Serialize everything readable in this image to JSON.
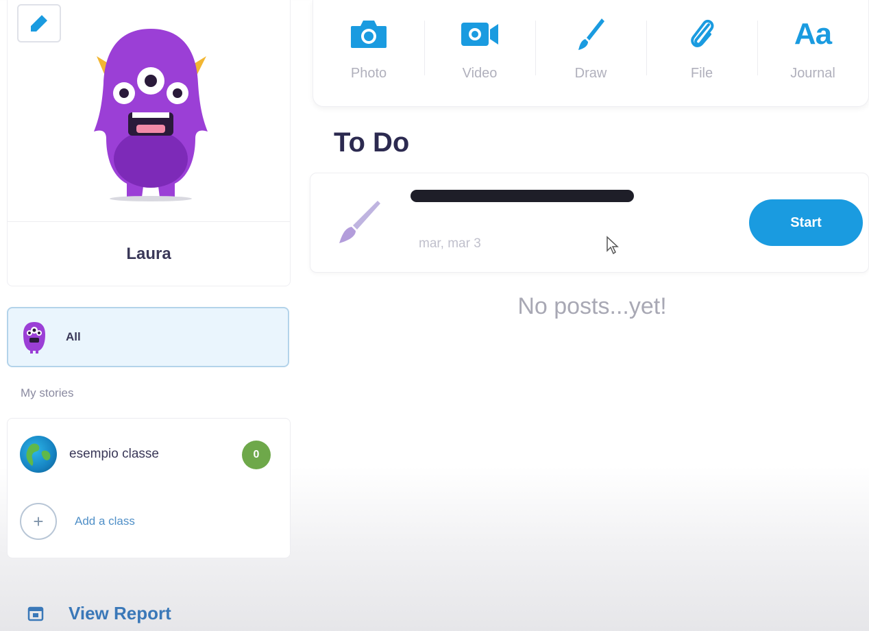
{
  "profile": {
    "name": "Laura",
    "avatar_icon": "purple-monster-avatar",
    "edit_icon": "pencil-icon"
  },
  "filters": {
    "all_label": "All",
    "section_label": "My stories"
  },
  "classes": {
    "items": [
      {
        "name": "esempio classe",
        "badge": "0",
        "icon": "globe-icon"
      }
    ],
    "add_label": "Add a class"
  },
  "report": {
    "label": "View Report",
    "icon": "calendar-icon"
  },
  "create_toolbar": {
    "tools": [
      {
        "label": "Photo",
        "icon": "camera-icon"
      },
      {
        "label": "Video",
        "icon": "video-camera-icon"
      },
      {
        "label": "Draw",
        "icon": "paintbrush-icon"
      },
      {
        "label": "File",
        "icon": "paperclip-icon"
      },
      {
        "label": "Journal",
        "icon": "text-icon",
        "glyph": "Aa"
      }
    ]
  },
  "todo": {
    "title": "To Do",
    "items": [
      {
        "name": "",
        "date": "mar, mar 3",
        "icon": "paintbrush-icon",
        "action": "Start"
      }
    ]
  },
  "feed": {
    "empty_text": "No posts...yet!"
  },
  "colors": {
    "accent": "#1a9be0",
    "avatar_purple": "#9b3fd6",
    "badge_green": "#6ea84a",
    "link_blue": "#3a78b8"
  }
}
